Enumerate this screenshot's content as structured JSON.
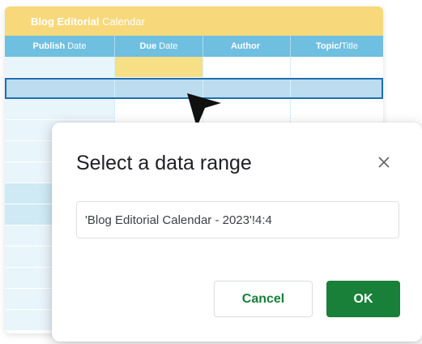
{
  "sheet": {
    "banner_bold": "Blog Editorial",
    "banner_rest": "Calendar",
    "headers": [
      {
        "bold": "Publish",
        "rest": "Date"
      },
      {
        "bold": "Due",
        "rest": "Date"
      },
      {
        "bold": "Author",
        "rest": ""
      },
      {
        "bold": "Topic/",
        "rest": "Title"
      }
    ],
    "row_count": 13,
    "selected_row": 2
  },
  "dialog": {
    "title": "Select a data range",
    "range_value": "'Blog Editorial Calendar - 2023'!4:4",
    "cancel_label": "Cancel",
    "ok_label": "OK"
  },
  "colors": {
    "banner": "#f7d97b",
    "header": "#6fbfe0",
    "accent_green": "#188038",
    "selection_border": "#1f6fb2"
  },
  "icons": {
    "close": "close-icon",
    "cursor": "cursor-arrow-icon"
  }
}
